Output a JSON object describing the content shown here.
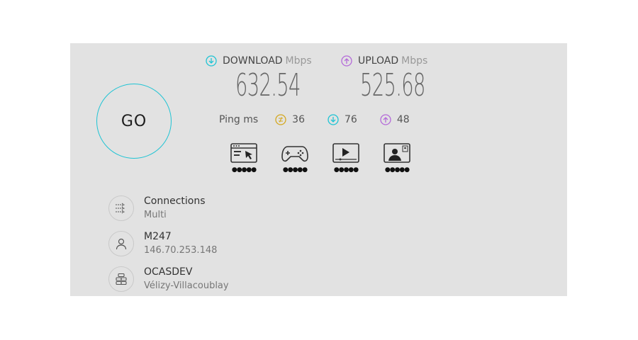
{
  "go_label": "GO",
  "download": {
    "label": "DOWNLOAD",
    "unit": "Mbps",
    "value": "632.54",
    "icon": "arrow-down-circle-icon",
    "color": "#1fc4d4"
  },
  "upload": {
    "label": "UPLOAD",
    "unit": "Mbps",
    "value": "525.68",
    "icon": "arrow-up-circle-icon",
    "color": "#b46ad9"
  },
  "ping": {
    "label": "Ping ms",
    "idle": {
      "value": "36",
      "icon": "jitter-icon",
      "color": "#d4a820"
    },
    "download": {
      "value": "76",
      "icon": "arrow-down-circle-icon",
      "color": "#1fc4d4"
    },
    "upload": {
      "value": "48",
      "icon": "arrow-up-circle-icon",
      "color": "#b46ad9"
    }
  },
  "activities": [
    {
      "name": "web-browsing-icon",
      "rating": "●●●●●"
    },
    {
      "name": "gaming-icon",
      "rating": "●●●●●"
    },
    {
      "name": "video-streaming-icon",
      "rating": "●●●●●"
    },
    {
      "name": "video-call-icon",
      "rating": "●●●●●"
    }
  ],
  "connections": {
    "title": "Connections",
    "value": "Multi",
    "icon": "connections-icon"
  },
  "isp": {
    "title": "M247",
    "value": "146.70.253.148",
    "icon": "user-icon"
  },
  "server": {
    "title": "OCASDEV",
    "value": "Vélizy-Villacoublay",
    "icon": "server-icon"
  }
}
